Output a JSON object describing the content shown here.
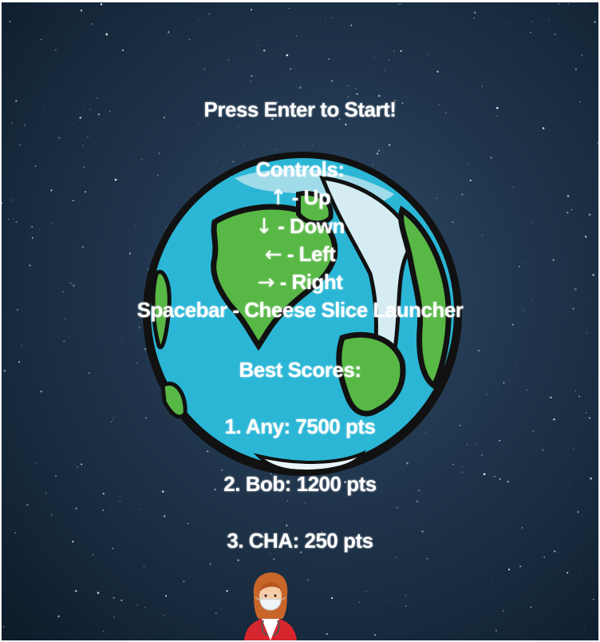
{
  "screen": {
    "start_prompt": "Press Enter to Start!",
    "controls_heading": "Controls:",
    "controls": [
      {
        "key": "↑",
        "action": " - Up"
      },
      {
        "key": "↓",
        "action": " - Down"
      },
      {
        "key": "←",
        "action": " - Left"
      },
      {
        "key": "→",
        "action": " - Right"
      },
      {
        "key": "Spacebar",
        "action": " - Cheese Slice Launcher"
      }
    ],
    "best_scores_heading": "Best Scores:",
    "scores": [
      "1. Any: 7500 pts",
      "2. Bob: 1200 pts",
      "3. CHA: 250 pts"
    ]
  },
  "images": {
    "background": "starfield",
    "globe": "earth-illustration",
    "character": "nurse-with-mask"
  },
  "colors": {
    "text": "#ffffff",
    "ocean": "#2bb6d6",
    "land": "#58b845",
    "ice": "#cfe8ef"
  }
}
